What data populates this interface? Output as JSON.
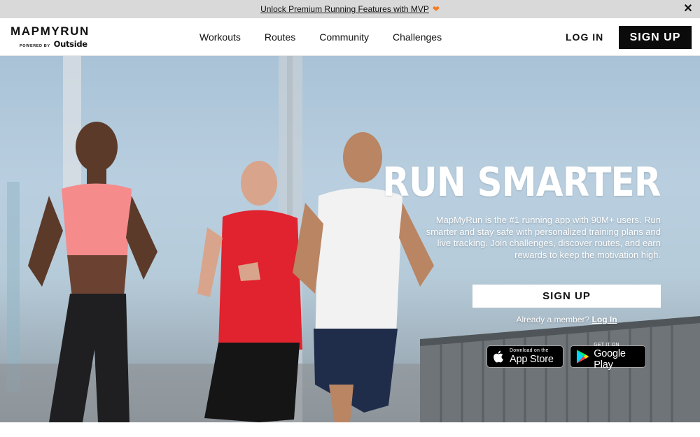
{
  "promo": {
    "text": "Unlock Premium Running Features with MVP",
    "icon": "orange-heart-icon",
    "close_icon": "close-icon"
  },
  "header": {
    "logo_main": "MAPMYRUN",
    "logo_powered": "POWERED BY",
    "logo_brand": "Outside",
    "nav": [
      "Workouts",
      "Routes",
      "Community",
      "Challenges"
    ],
    "login": "LOG IN",
    "signup": "SIGN UP"
  },
  "hero": {
    "title": "RUN SMARTER",
    "description": "MapMyRun is the #1 running app with 90M+ users. Run smarter and stay safe with personalized training plans and live tracking. Join challenges, discover routes, and earn rewards to keep the motivation high.",
    "signup": "SIGN UP",
    "member_text": "Already a member?",
    "member_login": "Log In",
    "app_store": {
      "small": "Download on the",
      "big": "App Store",
      "icon": "apple-icon"
    },
    "google_play": {
      "small": "GET IT ON",
      "big": "Google Play",
      "icon": "google-play-icon"
    }
  },
  "colors": {
    "accent_heart": "#f47b20",
    "signup_bg": "#0b0b0b",
    "promo_bg": "#d9d9d9"
  }
}
